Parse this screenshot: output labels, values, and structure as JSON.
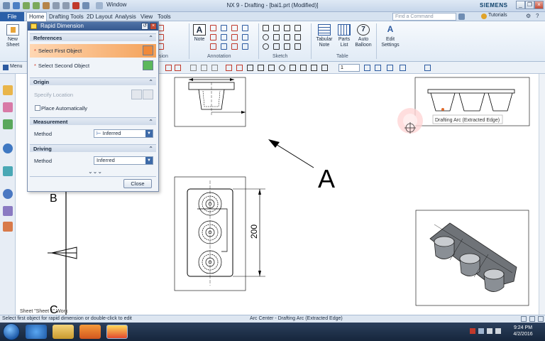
{
  "window": {
    "title": "NX 9 - Drafting - [bai1.prt (Modified)]",
    "window_menu": "Window",
    "brand": "SIEMENS",
    "controls": [
      "_",
      "❐",
      "×"
    ]
  },
  "menubar": {
    "tabs": [
      "File",
      "Home",
      "Drafting Tools",
      "2D Layout",
      "Analysis",
      "View",
      "Tools"
    ],
    "active_tab": "Home",
    "find_command_placeholder": "Find a Command",
    "tutorials": "Tutorials"
  },
  "ribbon": {
    "new_sheet": [
      "New",
      "Sheet"
    ],
    "note": "Note",
    "annotation_group": "Annotation",
    "sketch_group": "Sketch",
    "dimension_group_partial": "sion",
    "tabular_note": [
      "Tabular",
      "Note"
    ],
    "parts_list": [
      "Parts",
      "List"
    ],
    "auto_balloon": [
      "Auto",
      "Balloon"
    ],
    "table_group": "Table",
    "edit_settings": [
      "Edit",
      "Settings"
    ]
  },
  "selbar": {
    "menu_label": "Menu",
    "selection_value": "1"
  },
  "dialog": {
    "title": "Rapid Dimension",
    "sections": {
      "references": "References",
      "origin": "Origin",
      "measurement": "Measurement",
      "driving": "Driving"
    },
    "select_first": "Select First Object",
    "select_second": "Select Second Object",
    "specify_location": "Specify Location",
    "place_automatically": "Place Automatically",
    "measurement_method_label": "Method",
    "measurement_method_value": "Inferred",
    "driving_method_label": "Method",
    "driving_method_value": "Inferred",
    "more": "⌄⌄⌄",
    "close": "Close"
  },
  "drawing": {
    "letter_a": "A",
    "letter_b": "B",
    "letter_c": "C",
    "dimension_200": "200",
    "tooltip": "Drafting Arc (Extracted Edge)",
    "sheet_label": "Sheet \"Sheet 1\" Work"
  },
  "status": {
    "left": "Select first object for rapid dimension or double-click to edit",
    "center": "Arc Center - Drafting Arc (Extracted Edge)"
  },
  "taskbar": {
    "time": "9:24 PM",
    "date": "4/2/2016"
  },
  "colors": {
    "title_blue": "#36598e",
    "file_tab": "#2b5fa8",
    "highlight_orange": "#f4a25a",
    "select_green": "#5cb85c",
    "cursor_glow": "#ff6a6a"
  }
}
